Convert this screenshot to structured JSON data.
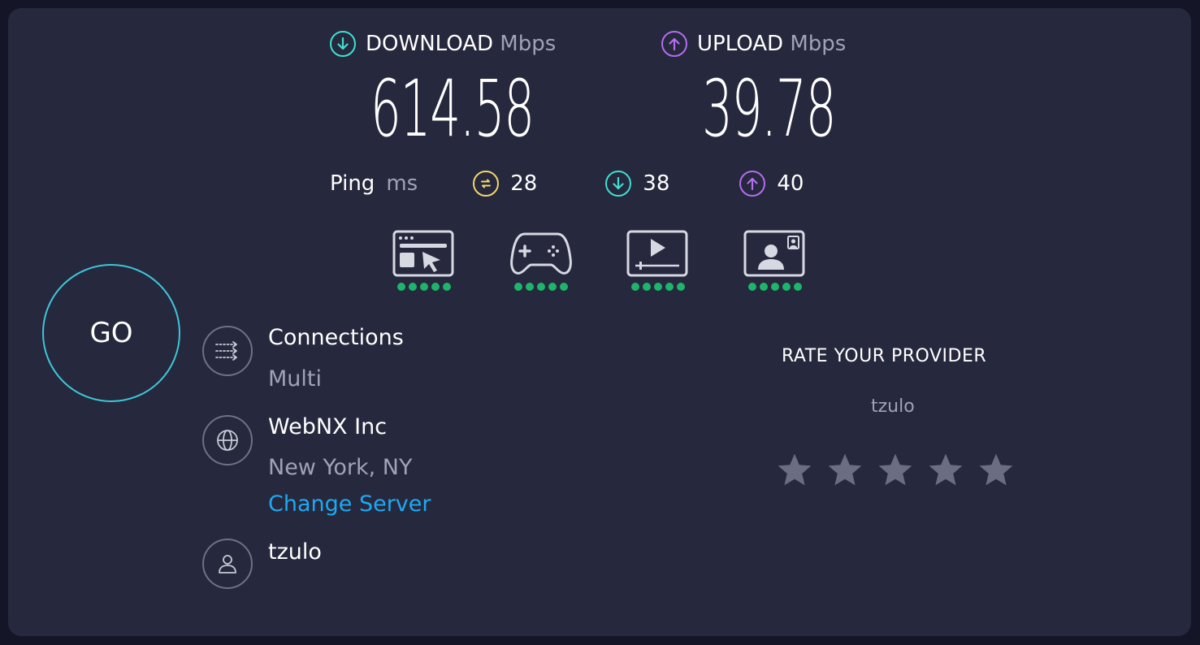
{
  "download": {
    "label": "DOWNLOAD",
    "unit": "Mbps",
    "value": "614.58",
    "color": "#3ee0d0"
  },
  "upload": {
    "label": "UPLOAD",
    "unit": "Mbps",
    "value": "39.78",
    "color": "#b46cf0"
  },
  "ping": {
    "label": "Ping",
    "unit": "ms",
    "idle": "28",
    "download": "38",
    "upload": "40",
    "idle_color": "#f3d66b"
  },
  "activities": [
    {
      "icon": "browsing-icon",
      "rating": 5
    },
    {
      "icon": "gaming-icon",
      "rating": 5
    },
    {
      "icon": "streaming-icon",
      "rating": 5
    },
    {
      "icon": "video-call-icon",
      "rating": 5
    }
  ],
  "go_label": "GO",
  "connections": {
    "title": "Connections",
    "value": "Multi"
  },
  "server": {
    "name": "WebNX Inc",
    "location": "New York, NY",
    "change_label": "Change Server"
  },
  "provider": {
    "name": "tzulo"
  },
  "rate": {
    "title": "RATE YOUR PROVIDER",
    "provider": "tzulo",
    "stars": 5
  },
  "colors": {
    "background": "#141526",
    "card": "#26283d",
    "accent": "#1da9f2",
    "rating_dot": "#1db56a"
  }
}
